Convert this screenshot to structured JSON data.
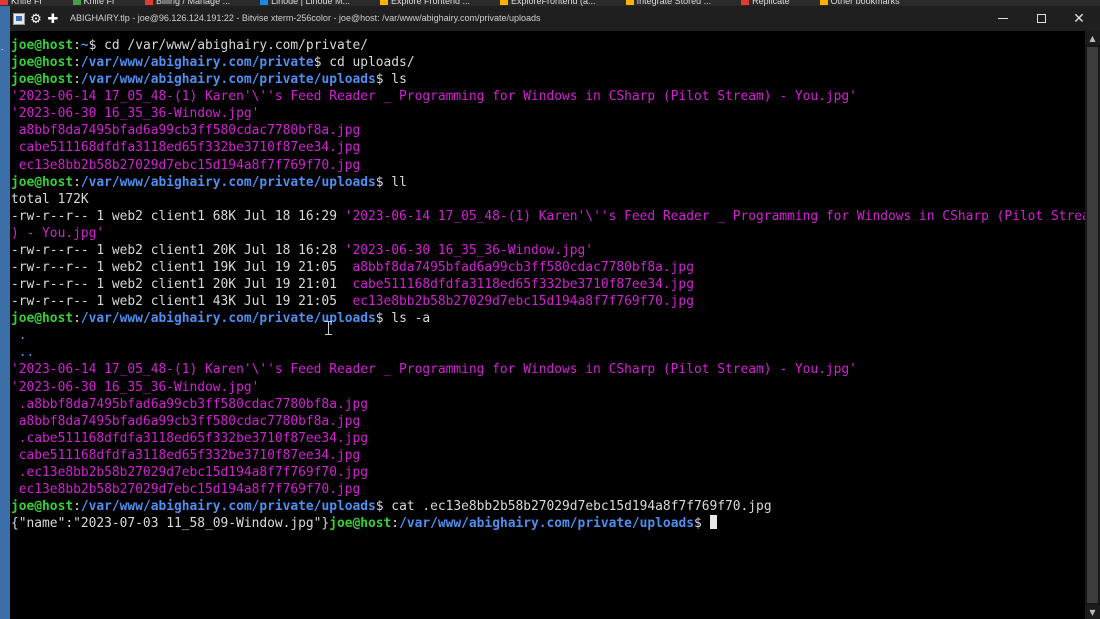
{
  "taskbar": {
    "bookmarks": [
      {
        "label": "Knife Fr",
        "color": "#e53935"
      },
      {
        "label": "Knife Fr",
        "color": "#43a047"
      },
      {
        "label": "Billing / Manage ...",
        "color": "#e53935"
      },
      {
        "label": "Linode | Linode M...",
        "color": "#1e88e5"
      },
      {
        "label": "Explore Frontend ...",
        "color": "#ffb300"
      },
      {
        "label": "ExploreFrontend (a...",
        "color": "#ffb300"
      },
      {
        "label": "Integrate Stored ...",
        "color": "#ffb300"
      },
      {
        "label": "Replicate",
        "color": "#e53935"
      },
      {
        "label": "Other bookmarks",
        "color": "#ffb300"
      }
    ]
  },
  "window": {
    "title": "ABIGHAIRY.tlp - joe@96.126.124.191:22 - Bitvise xterm-256color - joe@host: /var/www/abighairy.com/private/uploads"
  },
  "terminal": {
    "lines": [
      [
        {
          "t": "joe@host",
          "c": "ug"
        },
        {
          "t": ":",
          "c": ""
        },
        {
          "t": "~",
          "c": "path"
        },
        {
          "t": "$ cd /var/www/abighairy.com/private/",
          "c": ""
        }
      ],
      [
        {
          "t": "joe@host",
          "c": "ug"
        },
        {
          "t": ":",
          "c": ""
        },
        {
          "t": "/var/www/abighairy.com/private",
          "c": "path"
        },
        {
          "t": "$ cd uploads/",
          "c": ""
        }
      ],
      [
        {
          "t": "joe@host",
          "c": "ug"
        },
        {
          "t": ":",
          "c": ""
        },
        {
          "t": "/var/www/abighairy.com/private/uploads",
          "c": "path"
        },
        {
          "t": "$ ls",
          "c": ""
        }
      ],
      [
        {
          "t": "'2023-06-14 17_05_48-(1) Karen'\\''s Feed Reader _ Programming for Windows in CSharp (Pilot Stream) - You.jpg'",
          "c": "mag"
        }
      ],
      [
        {
          "t": "'2023-06-30 16_35_36-Window.jpg'",
          "c": "mag"
        }
      ],
      [
        {
          "t": " a8bbf8da7495bfad6a99cb3ff580cdac7780bf8a.jpg",
          "c": "mag"
        }
      ],
      [
        {
          "t": " cabe511168dfdfa3118ed65f332be3710f87ee34.jpg",
          "c": "mag"
        }
      ],
      [
        {
          "t": " ec13e8bb2b58b27029d7ebc15d194a8f7f769f70.jpg",
          "c": "mag"
        }
      ],
      [
        {
          "t": "joe@host",
          "c": "ug"
        },
        {
          "t": ":",
          "c": ""
        },
        {
          "t": "/var/www/abighairy.com/private/uploads",
          "c": "path"
        },
        {
          "t": "$ ll",
          "c": ""
        }
      ],
      [
        {
          "t": "total 172K",
          "c": ""
        }
      ],
      [
        {
          "t": "-rw-r--r-- 1 web2 client1 68K Jul 18 16:29 ",
          "c": ""
        },
        {
          "t": "'2023-06-14 17_05_48-(1) Karen'\\''s Feed Reader _ Programming for Windows in CSharp (Pilot Stream",
          "c": "mag"
        }
      ],
      [
        {
          "t": ") - You.jpg'",
          "c": "mag"
        }
      ],
      [
        {
          "t": "-rw-r--r-- 1 web2 client1 20K Jul 18 16:28 ",
          "c": ""
        },
        {
          "t": "'2023-06-30 16_35_36-Window.jpg'",
          "c": "mag"
        }
      ],
      [
        {
          "t": "-rw-r--r-- 1 web2 client1 19K Jul 19 21:05 ",
          "c": ""
        },
        {
          "t": " a8bbf8da7495bfad6a99cb3ff580cdac7780bf8a.jpg",
          "c": "mag"
        }
      ],
      [
        {
          "t": "-rw-r--r-- 1 web2 client1 20K Jul 19 21:01 ",
          "c": ""
        },
        {
          "t": " cabe511168dfdfa3118ed65f332be3710f87ee34.jpg",
          "c": "mag"
        }
      ],
      [
        {
          "t": "-rw-r--r-- 1 web2 client1 43K Jul 19 21:05 ",
          "c": ""
        },
        {
          "t": " ec13e8bb2b58b27029d7ebc15d194a8f7f769f70.jpg",
          "c": "mag"
        }
      ],
      [
        {
          "t": "joe@host",
          "c": "ug"
        },
        {
          "t": ":",
          "c": ""
        },
        {
          "t": "/var/www/abighairy.com/private/uploads",
          "c": "path"
        },
        {
          "t": "$ ls -a",
          "c": ""
        }
      ],
      [
        {
          "t": " .",
          "c": "blu"
        }
      ],
      [
        {
          "t": " ..",
          "c": "blu"
        }
      ],
      [
        {
          "t": "'2023-06-14 17_05_48-(1) Karen'\\''s Feed Reader _ Programming for Windows in CSharp (Pilot Stream) - You.jpg'",
          "c": "mag"
        }
      ],
      [
        {
          "t": "'2023-06-30 16_35_36-Window.jpg'",
          "c": "mag"
        }
      ],
      [
        {
          "t": " .a8bbf8da7495bfad6a99cb3ff580cdac7780bf8a.jpg",
          "c": "mag"
        }
      ],
      [
        {
          "t": " a8bbf8da7495bfad6a99cb3ff580cdac7780bf8a.jpg",
          "c": "mag"
        }
      ],
      [
        {
          "t": " .cabe511168dfdfa3118ed65f332be3710f87ee34.jpg",
          "c": "mag"
        }
      ],
      [
        {
          "t": " cabe511168dfdfa3118ed65f332be3710f87ee34.jpg",
          "c": "mag"
        }
      ],
      [
        {
          "t": " .ec13e8bb2b58b27029d7ebc15d194a8f7f769f70.jpg",
          "c": "mag"
        }
      ],
      [
        {
          "t": " ec13e8bb2b58b27029d7ebc15d194a8f7f769f70.jpg",
          "c": "mag"
        }
      ],
      [
        {
          "t": "joe@host",
          "c": "ug"
        },
        {
          "t": ":",
          "c": ""
        },
        {
          "t": "/var/www/abighairy.com/private/uploads",
          "c": "path"
        },
        {
          "t": "$ cat .ec13e8bb2b58b27029d7ebc15d194a8f7f769f70.jpg",
          "c": ""
        }
      ],
      [
        {
          "t": "{\"name\":\"2023-07-03 11_58_09-Window.jpg\"}",
          "c": ""
        },
        {
          "t": "joe@host",
          "c": "ug"
        },
        {
          "t": ":",
          "c": ""
        },
        {
          "t": "/var/www/abighairy.com/private/uploads",
          "c": "path"
        },
        {
          "t": "$ ",
          "c": ""
        },
        {
          "t": "",
          "c": "cursor"
        }
      ]
    ]
  },
  "colors": {
    "user_host": "#35d135",
    "path": "#4e8ff0",
    "file_jpg": "#d221d2",
    "dir": "#4e8ff0",
    "text": "#d9d9d9",
    "background": "#000000"
  },
  "icons": {
    "app": "bitvise-terminal-icon",
    "settings": "gear-icon",
    "new": "plus-icon",
    "minimize": "minimize-icon",
    "maximize": "maximize-icon",
    "close": "close-icon"
  }
}
